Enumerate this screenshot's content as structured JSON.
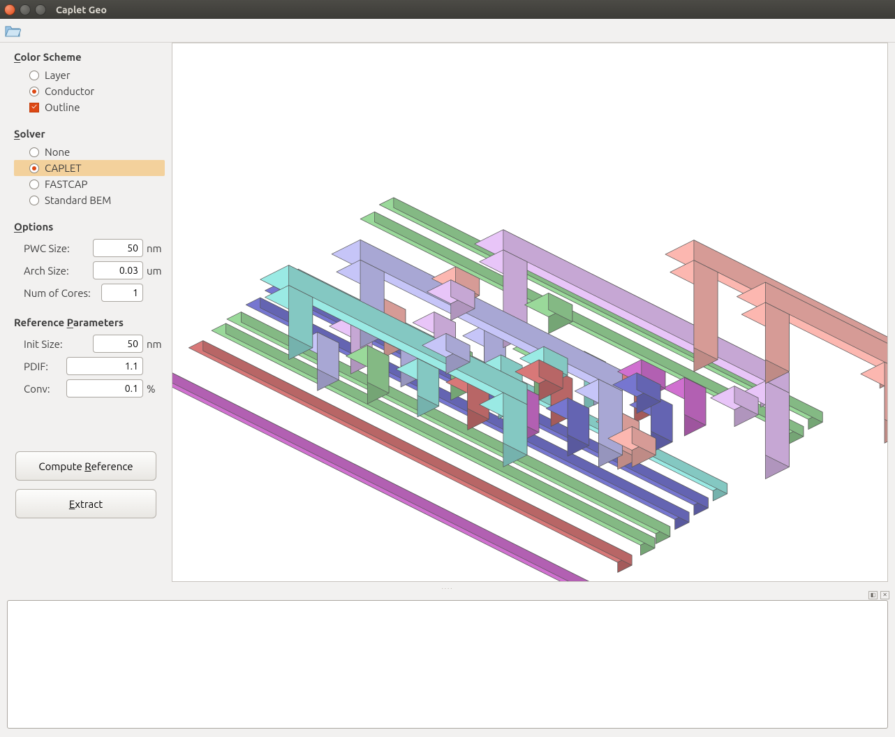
{
  "app": {
    "title": "Caplet Geo"
  },
  "sidebar": {
    "color_scheme": {
      "title": "Color Scheme",
      "accel": "C",
      "options": [
        {
          "label": "Layer",
          "kind": "radio",
          "checked": false
        },
        {
          "label": "Conductor",
          "kind": "radio",
          "checked": true
        },
        {
          "label": "Outline",
          "kind": "checkbox",
          "checked": true
        }
      ]
    },
    "solver": {
      "title": "Solver",
      "accel": "S",
      "options": [
        {
          "label": "None",
          "checked": false
        },
        {
          "label": "CAPLET",
          "checked": true,
          "highlight": true
        },
        {
          "label": "FASTCAP",
          "checked": false
        },
        {
          "label": "Standard BEM",
          "checked": false
        }
      ]
    },
    "options": {
      "title": "Options",
      "accel": "O",
      "fields": [
        {
          "label": "PWC Size:",
          "value": "50",
          "unit": "nm"
        },
        {
          "label": "Arch Size:",
          "value": "0.03",
          "unit": "um"
        },
        {
          "label": "Num of Cores:",
          "value": "1",
          "unit": ""
        }
      ]
    },
    "reference": {
      "title": "Reference Parameters",
      "accel": "P",
      "fields": [
        {
          "label": "Init Size:",
          "value": "50",
          "unit": "nm"
        },
        {
          "label": "PDIF:",
          "value": "1.1",
          "unit": "",
          "wide": true
        },
        {
          "label": "Conv:",
          "value": "0.1",
          "unit": "%",
          "wide": true
        }
      ]
    },
    "buttons": {
      "compute_reference": "Compute Reference",
      "extract": "Extract"
    }
  },
  "viewport": {
    "conductor_colors": [
      "#e9a9a3",
      "#d7b6e6",
      "#b7b6e6",
      "#8fc98f",
      "#8fd9d3",
      "#c86f6f",
      "#c168c1",
      "#6d6dc1"
    ]
  }
}
